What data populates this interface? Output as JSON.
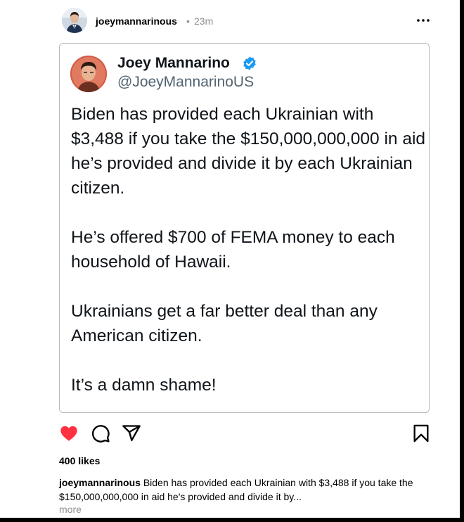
{
  "post": {
    "username": "joeymannarinous",
    "separator": "•",
    "time": "23m",
    "likes_label": "400 likes",
    "caption_user": "joeymannarinous",
    "caption_text": "Biden has provided each Ukrainian with $3,488 if you take the $150,000,000,000 in aid he's provided and divide it by...",
    "more_label": "more",
    "liked": true
  },
  "tweet": {
    "name": "Joey Mannarino",
    "handle": "@JoeyMannarinoUS",
    "verified": true,
    "paragraphs": [
      "Biden has provided each Ukrainian with $3,488 if you take the $150,000,000,000 in aid he’s provided and divide it by each Ukrainian citizen.",
      "He’s offered $700 of FEMA money to each household of Hawaii.",
      "Ukrainians get a far better deal than any American citizen.",
      "It’s a damn shame!"
    ]
  },
  "icons": {
    "more": "more-horizontal-icon",
    "like": "heart-icon",
    "comment": "comment-icon",
    "share": "share-icon",
    "save": "bookmark-icon"
  },
  "colors": {
    "heart": "#ff3040",
    "verified": "#1d9bf0",
    "muted": "#8e8e8e",
    "handle": "#536471"
  }
}
